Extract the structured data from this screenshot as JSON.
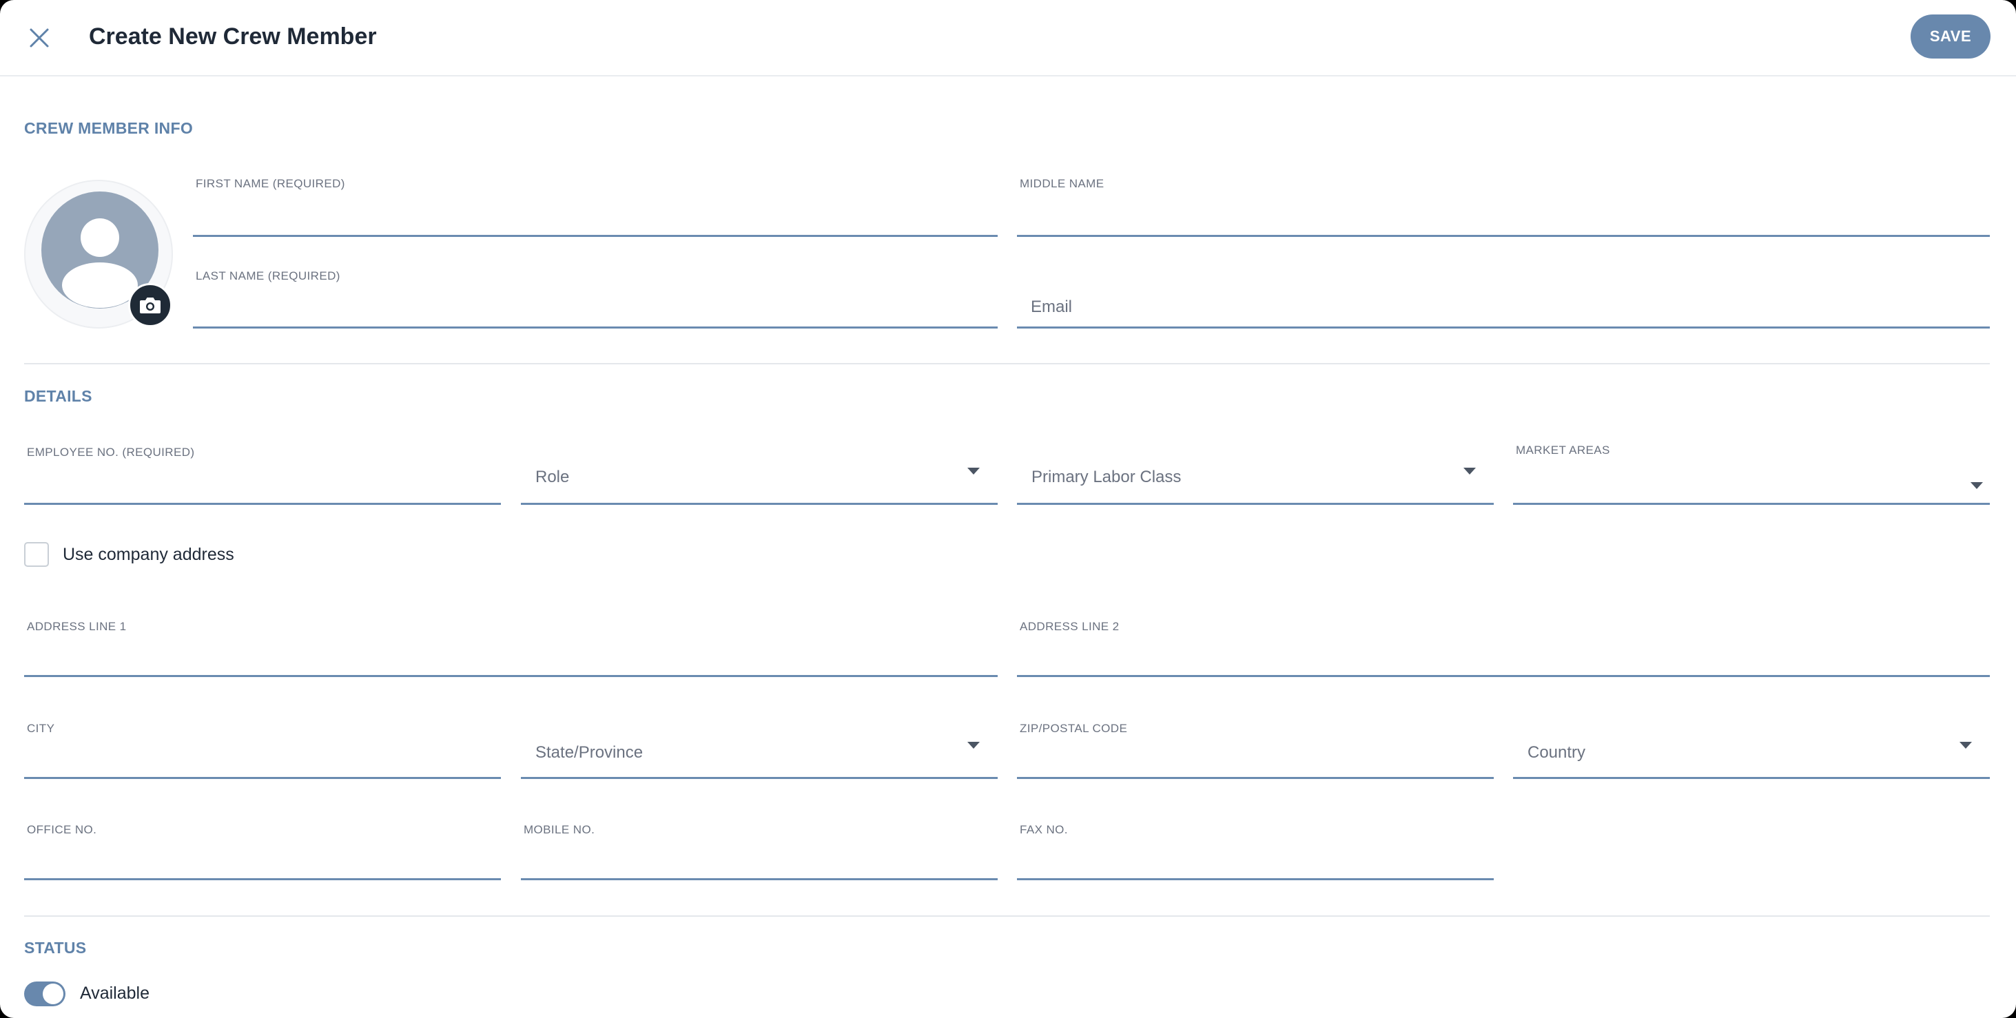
{
  "header": {
    "title": "Create New Crew Member",
    "save_label": "SAVE",
    "close_icon": "close-icon"
  },
  "sections": {
    "crew_info": "CREW MEMBER INFO",
    "details": "DETAILS",
    "status": "STATUS"
  },
  "crew_info": {
    "avatar_icon": "user-avatar-icon",
    "camera_icon": "camera-icon",
    "first_name": {
      "label": "FIRST NAME (REQUIRED)",
      "value": ""
    },
    "middle_name": {
      "label": "MIDDLE NAME",
      "value": ""
    },
    "last_name": {
      "label": "LAST NAME (REQUIRED)",
      "value": ""
    },
    "email": {
      "placeholder": "Email",
      "value": ""
    }
  },
  "details": {
    "employee_no": {
      "label": "EMPLOYEE NO. (REQUIRED)",
      "value": ""
    },
    "role": {
      "placeholder": "Role"
    },
    "primary_labor_class": {
      "placeholder": "Primary Labor Class"
    },
    "market_areas": {
      "label": "MARKET AREAS",
      "value": ""
    },
    "use_company_address": {
      "label": "Use company address",
      "checked": false
    },
    "address_line_1": {
      "label": "ADDRESS LINE 1",
      "value": ""
    },
    "address_line_2": {
      "label": "ADDRESS LINE 2",
      "value": ""
    },
    "city": {
      "label": "CITY",
      "value": ""
    },
    "state_province": {
      "placeholder": "State/Province"
    },
    "zip": {
      "label": "ZIP/POSTAL CODE",
      "value": ""
    },
    "country": {
      "placeholder": "Country"
    },
    "office_no": {
      "label": "OFFICE NO.",
      "value": ""
    },
    "mobile_no": {
      "label": "MOBILE NO.",
      "value": ""
    },
    "fax_no": {
      "label": "FAX NO.",
      "value": ""
    }
  },
  "status": {
    "available": {
      "label": "Available",
      "on": true
    }
  },
  "colors": {
    "accent": "#6888ad",
    "section_title": "#5f82a9",
    "field_underline": "#6a8bb0",
    "avatar": "#96a6b9",
    "camera_button": "#1f2a36"
  }
}
